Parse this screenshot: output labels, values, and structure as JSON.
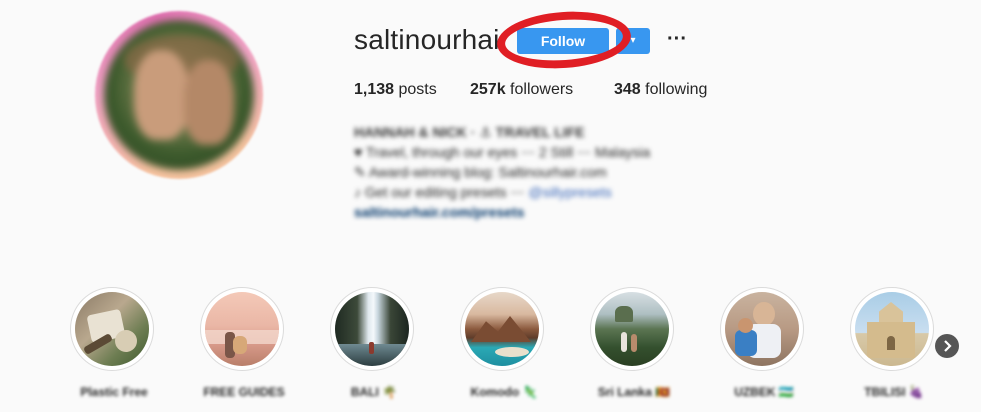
{
  "profile": {
    "username": "saltinourhair",
    "follow_label": "Follow",
    "dropdown_glyph": "▾",
    "more_glyph": "···",
    "stats": {
      "posts_count": "1,138",
      "posts_label": "posts",
      "followers_count": "257k",
      "followers_label": "followers",
      "following_count": "348",
      "following_label": "following"
    },
    "bio": {
      "name": "HANNAH & NICK · ⚓ TRAVEL LIFE",
      "line1": "♥  Travel, through our eyes ⋯ 2 Still ⋯ Malaysia",
      "line2": "✎  Award-winning blog: Saltinourhair.com",
      "line3": "♪  Get our editing presets ⋯ ",
      "line3_mention": "@sillypresets",
      "link": "saltinourhair.com/presets"
    }
  },
  "highlights": [
    {
      "label": "Plastic Free",
      "icon": "plastic-free-thumbnail"
    },
    {
      "label": "FREE GUIDES",
      "icon": "free-guides-thumbnail"
    },
    {
      "label": "BALI 🌴",
      "icon": "bali-thumbnail"
    },
    {
      "label": "Komodo 🦎",
      "icon": "komodo-thumbnail"
    },
    {
      "label": "Sri Lanka 🇱🇰",
      "icon": "sri-lanka-thumbnail"
    },
    {
      "label": "UZBEK 🇺🇿",
      "icon": "uzbek-thumbnail"
    },
    {
      "label": "TBILISI 🍇",
      "icon": "tbilisi-thumbnail"
    }
  ],
  "annotation_color": "#e01e24",
  "accent_color": "#3897f0"
}
